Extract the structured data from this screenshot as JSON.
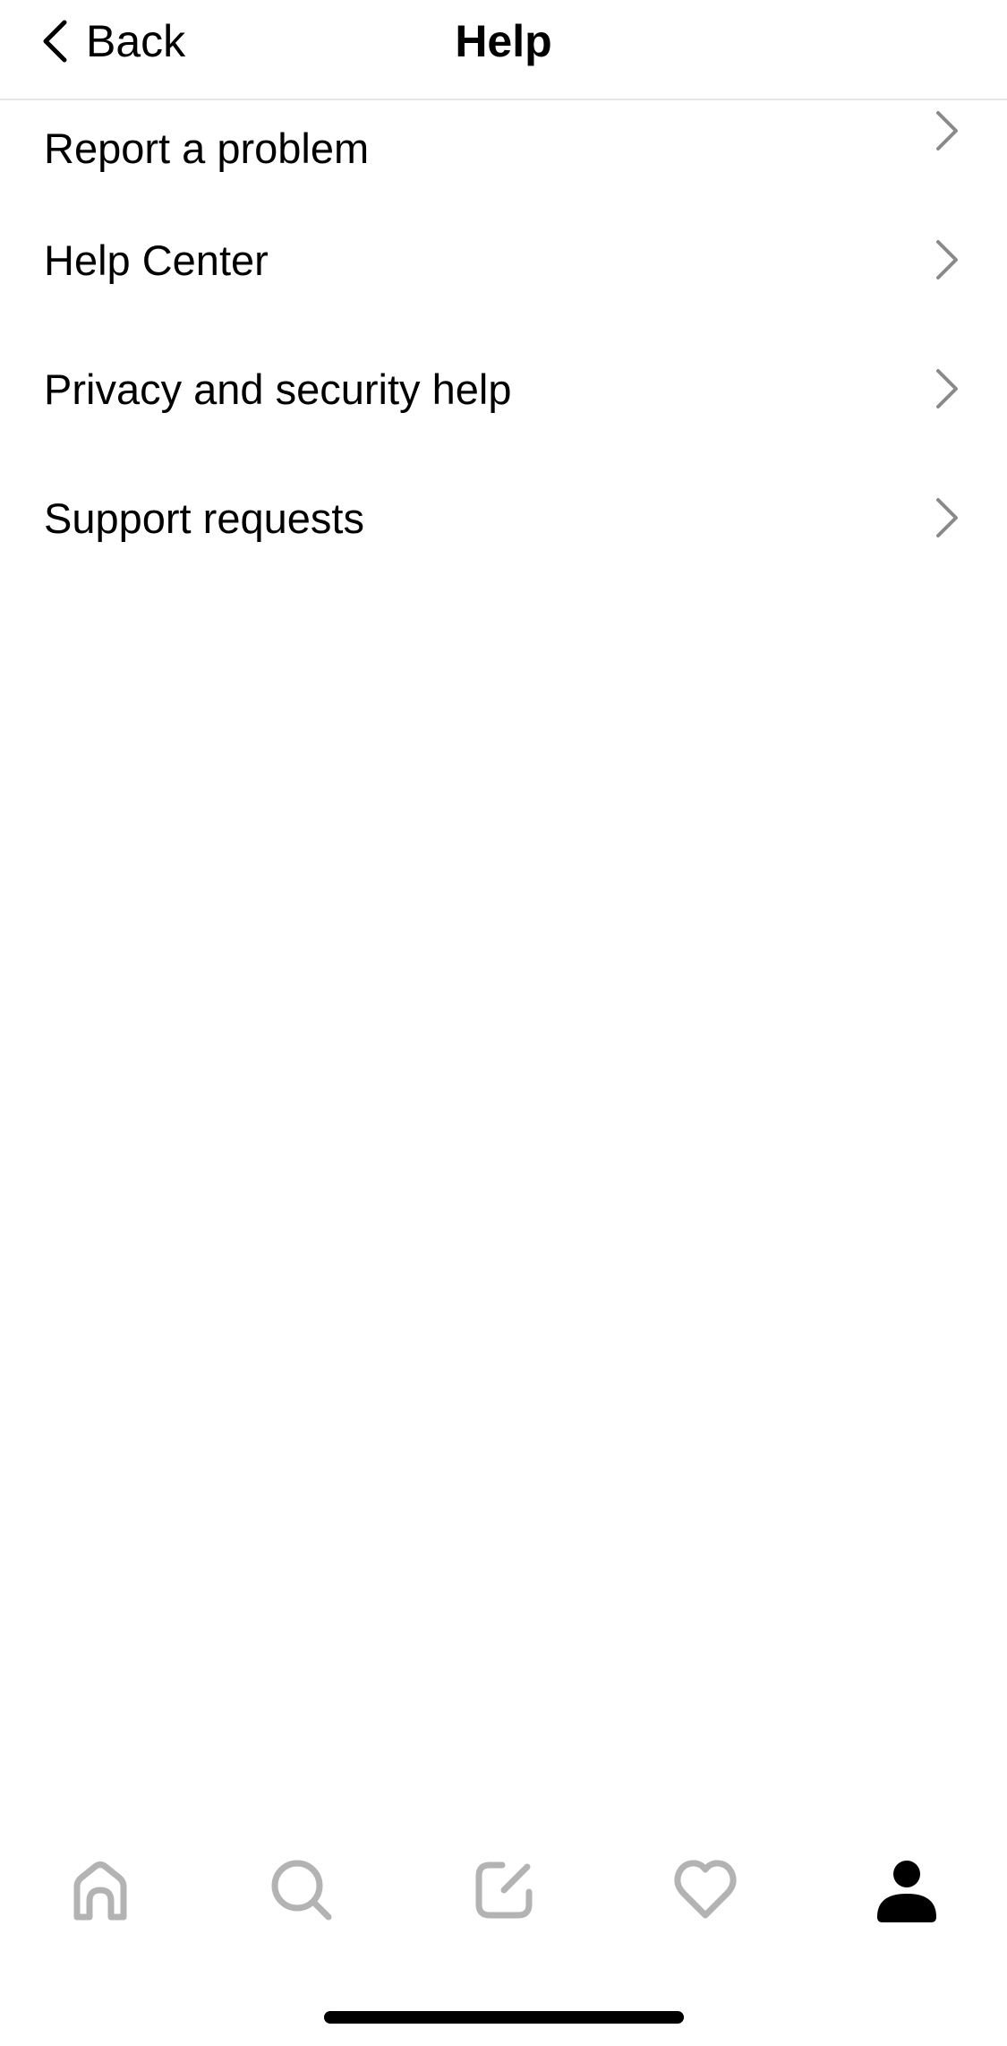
{
  "header": {
    "back_label": "Back",
    "title": "Help"
  },
  "menu": {
    "items": [
      {
        "label": "Report a problem",
        "icon": "chevron-right-icon"
      },
      {
        "label": "Help Center",
        "icon": "chevron-right-icon"
      },
      {
        "label": "Privacy and security help",
        "icon": "chevron-right-icon"
      },
      {
        "label": "Support requests",
        "icon": "chevron-right-icon"
      }
    ]
  },
  "tabbar": {
    "tabs": [
      {
        "name": "home",
        "icon": "home-icon",
        "active": false
      },
      {
        "name": "search",
        "icon": "search-icon",
        "active": false
      },
      {
        "name": "compose",
        "icon": "compose-icon",
        "active": false
      },
      {
        "name": "activity",
        "icon": "heart-icon",
        "active": false
      },
      {
        "name": "profile",
        "icon": "person-icon",
        "active": true
      }
    ],
    "inactive_color": "#b3b3b3",
    "active_color": "#000000"
  },
  "colors": {
    "chevron": "#8a8a8a",
    "divider": "#e6e6e6",
    "background": "#ffffff",
    "text": "#000000"
  }
}
